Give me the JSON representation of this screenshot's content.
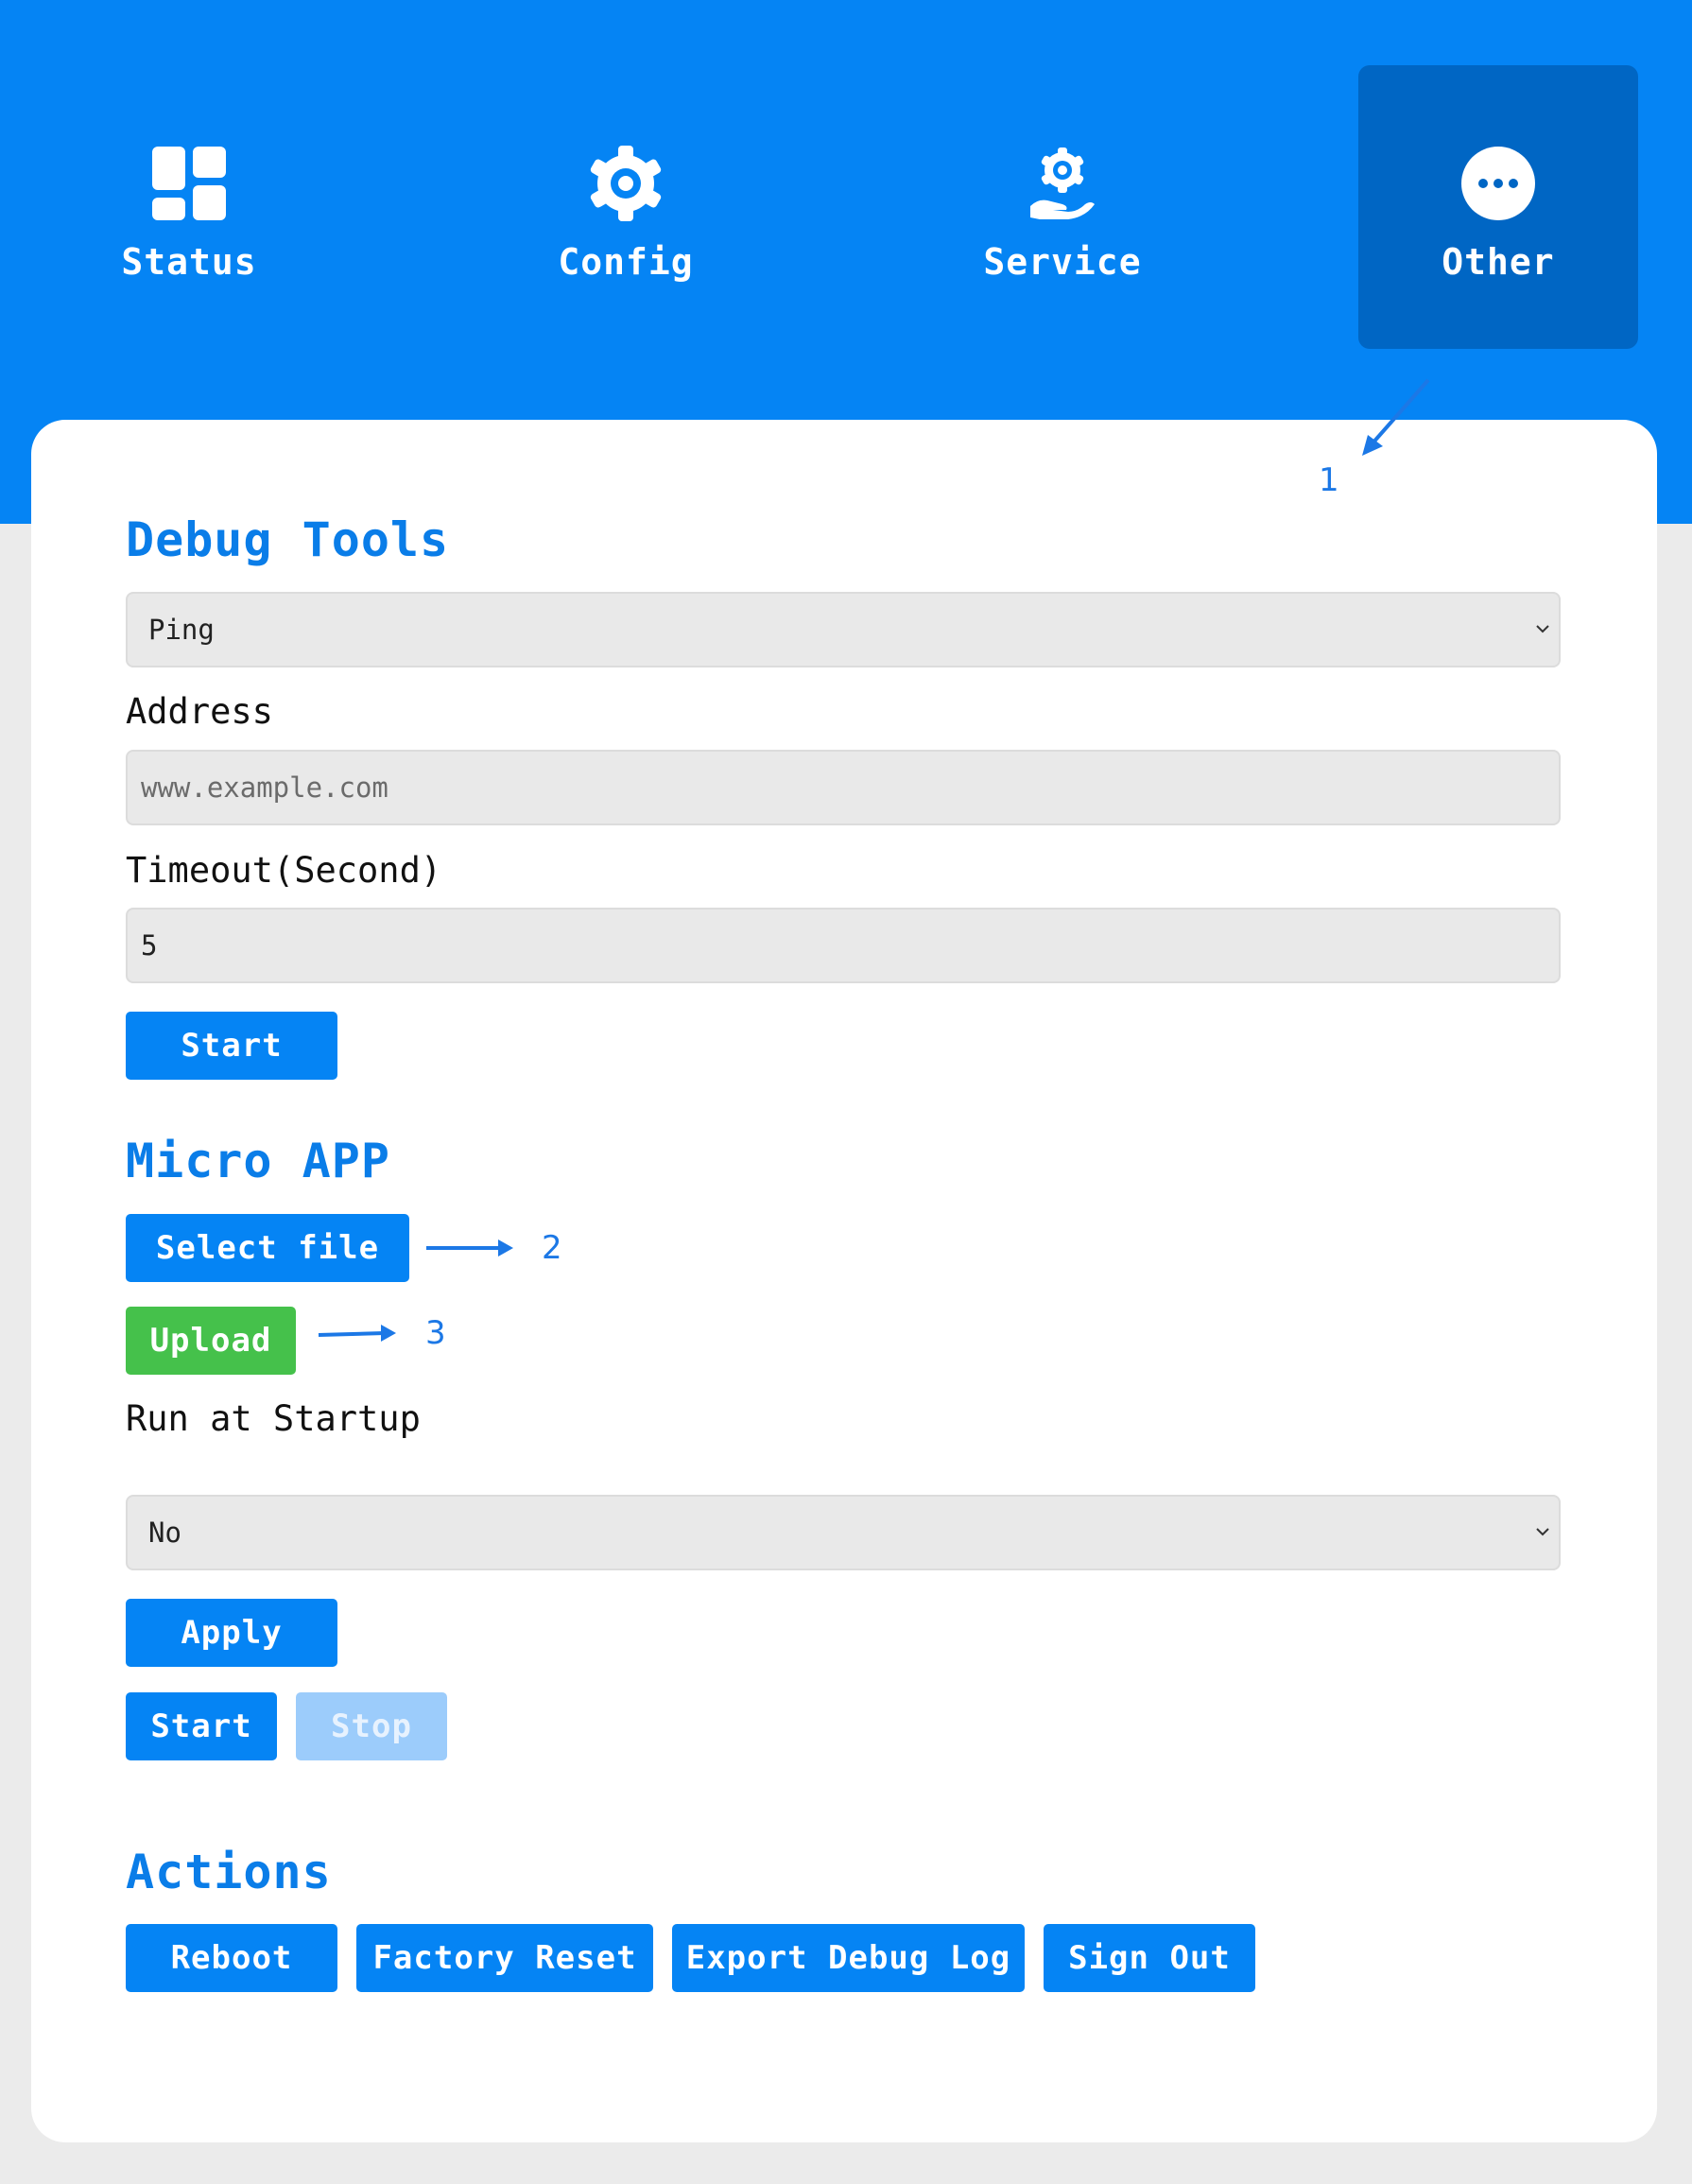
{
  "nav": {
    "items": [
      {
        "label": "Status",
        "icon": "grid-icon"
      },
      {
        "label": "Config",
        "icon": "gear-icon"
      },
      {
        "label": "Service",
        "icon": "service-hand-gear-icon"
      },
      {
        "label": "Other",
        "icon": "more-dots-icon",
        "active": true
      }
    ]
  },
  "debug_tools": {
    "title": "Debug Tools",
    "tool_select": "Ping",
    "address_label": "Address",
    "address_placeholder": "www.example.com",
    "timeout_label": "Timeout(Second)",
    "timeout_value": "5",
    "start_label": "Start"
  },
  "micro_app": {
    "title": "Micro APP",
    "select_file_label": "Select file",
    "upload_label": "Upload",
    "run_at_startup_label": "Run at Startup",
    "run_at_startup_value": "No",
    "apply_label": "Apply",
    "start_label": "Start",
    "stop_label": "Stop"
  },
  "actions": {
    "title": "Actions",
    "buttons": [
      "Reboot",
      "Factory Reset",
      "Export Debug Log",
      "Sign Out"
    ]
  },
  "annotations": {
    "callout_1": "1",
    "callout_2": "2",
    "callout_3": "3"
  },
  "colors": {
    "primary": "#0584f4",
    "nav_active": "#0066c4",
    "heading": "#0a7de8",
    "upload": "#45c14b",
    "disabled": "#9cccfb",
    "page_bg": "#ebebeb",
    "callout": "#1c78e6"
  }
}
